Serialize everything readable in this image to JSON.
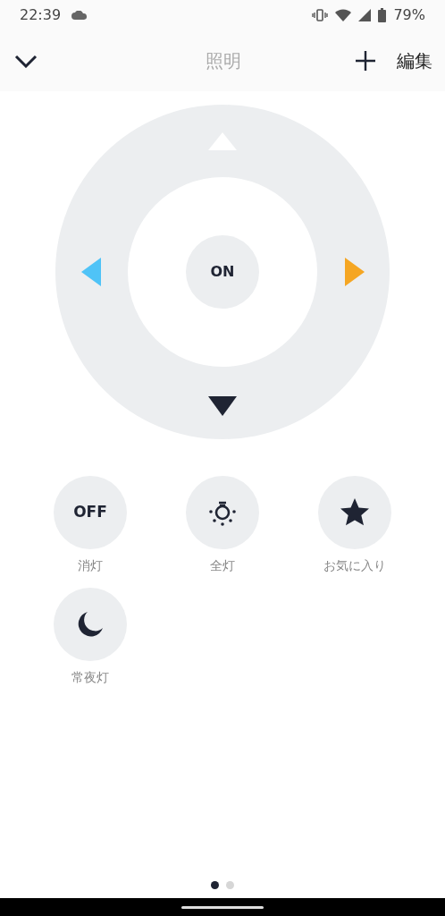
{
  "status_bar": {
    "time": "22:39",
    "battery": "79%"
  },
  "header": {
    "title": "照明",
    "edit": "編集"
  },
  "dpad": {
    "center": "ON",
    "arrows": [
      {
        "kind": "up",
        "color": "#ffffff"
      },
      {
        "kind": "left",
        "color": "#4fc3f7"
      },
      {
        "kind": "right",
        "color": "#f5a623"
      },
      {
        "kind": "down",
        "color": "#1f2433"
      }
    ]
  },
  "buttons": [
    {
      "kind": "text",
      "text": "OFF",
      "label": "消灯"
    },
    {
      "kind": "bulb",
      "label": "全灯"
    },
    {
      "kind": "star",
      "label": "お気に入り"
    },
    {
      "kind": "moon",
      "label": "常夜灯"
    }
  ],
  "pages": [
    {
      "selected": true
    },
    {
      "selected": false
    }
  ]
}
